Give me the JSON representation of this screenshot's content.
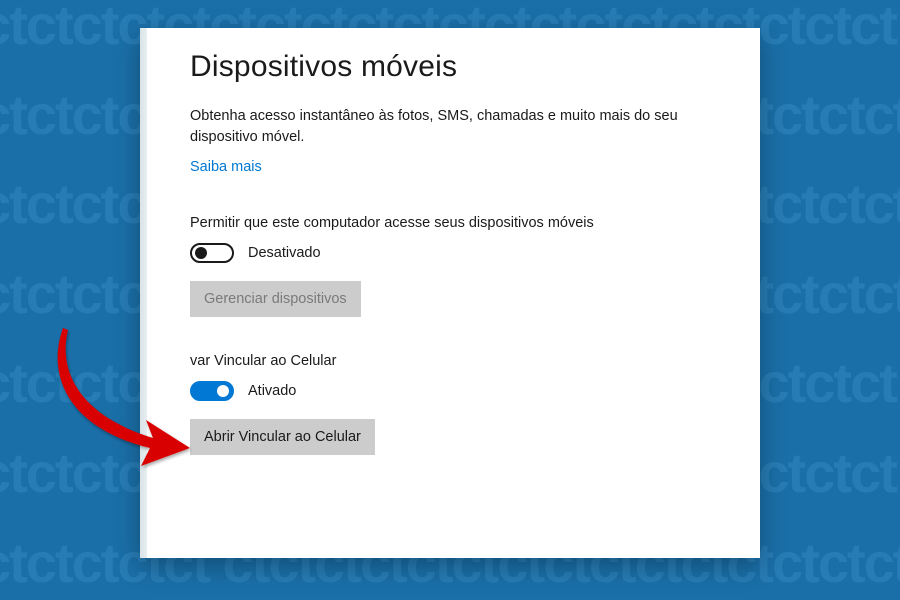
{
  "page": {
    "title": "Dispositivos móveis",
    "description": "Obtenha acesso instantâneo às fotos, SMS, chamadas e muito mais do seu dispositivo móvel.",
    "learn_more": "Saiba mais"
  },
  "settings": {
    "allow_access": {
      "label": "Permitir que este computador acesse seus dispositivos móveis",
      "state_label": "Desativado",
      "on": false
    },
    "manage_devices_button": "Gerenciar dispositivos",
    "phone_link": {
      "label_partial": "var Vincular ao Celular",
      "state_label": "Ativado",
      "on": true
    },
    "open_phone_link_button": "Abrir Vincular ao Celular"
  },
  "colors": {
    "accent": "#0078d4",
    "bg": "#1a6fa8",
    "arrow": "#d80000"
  }
}
